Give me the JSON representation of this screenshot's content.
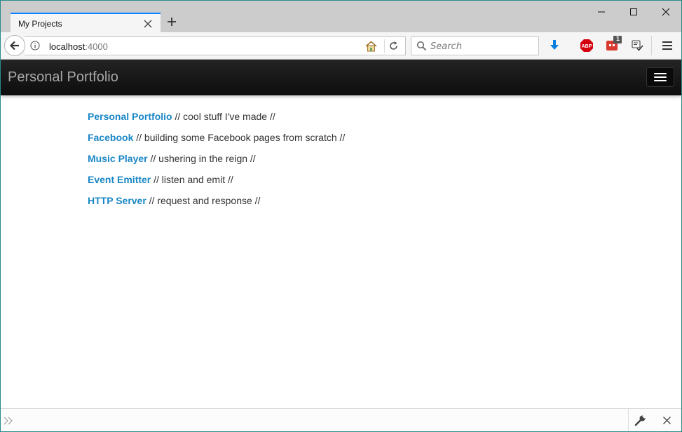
{
  "browser": {
    "tab": {
      "title": "My Projects"
    },
    "url": {
      "host": "localhost",
      "port": ":4000"
    },
    "search": {
      "placeholder": "Search"
    },
    "notification_badge": "1",
    "accent_color": "#0a84ff"
  },
  "page": {
    "brand": "Personal Portfolio",
    "link_color": "#1a87c6",
    "header_color": "#111111",
    "projects": [
      {
        "name": "Personal Portfolio",
        "description": " // cool stuff I've made //"
      },
      {
        "name": "Facebook",
        "description": " // building some Facebook pages from scratch //"
      },
      {
        "name": "Music Player",
        "description": " // ushering in the reign //"
      },
      {
        "name": "Event Emitter",
        "description": " // listen and emit //"
      },
      {
        "name": "HTTP Server",
        "description": " // request and response //"
      }
    ]
  },
  "icons": {
    "tab_close": "close-icon",
    "new_tab": "plus-icon",
    "minimize": "minimize-icon",
    "maximize": "maximize-icon",
    "close_window": "close-window-icon",
    "back": "back-arrow-icon",
    "info": "info-icon",
    "home": "home-icon",
    "reload": "reload-icon",
    "search": "search-icon",
    "download": "download-arrow-icon",
    "adblock": "adblock-plus-icon",
    "extension": "extension-icon",
    "screenshot": "screenshot-check-icon",
    "menu": "hamburger-menu-icon",
    "dev_prompt": "double-chevron-icon",
    "wrench": "wrench-icon",
    "dev_close": "close-icon"
  }
}
